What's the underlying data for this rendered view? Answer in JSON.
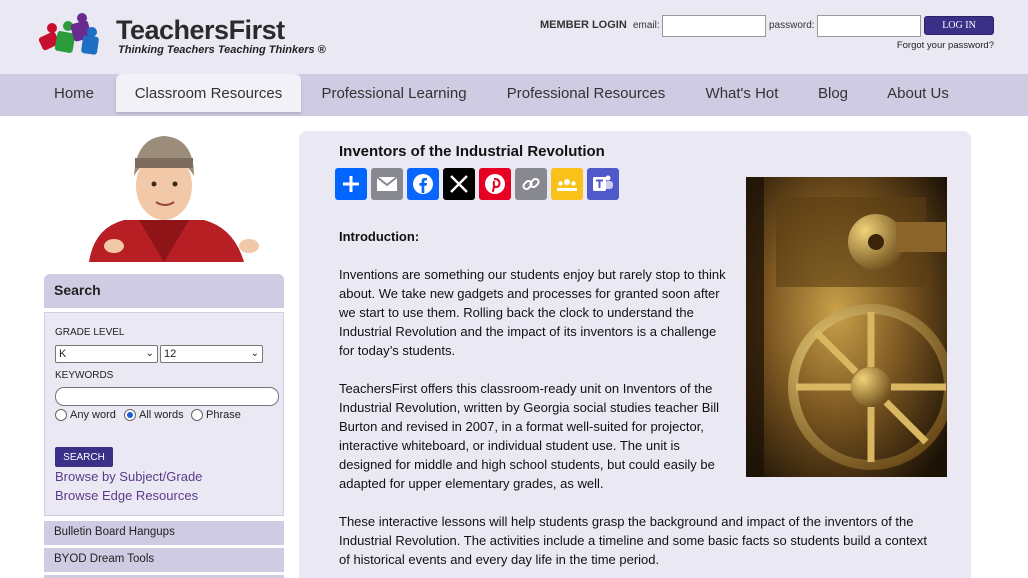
{
  "header": {
    "logo_name": "TeachersFirst",
    "logo_tagline": "Thinking Teachers Teaching Thinkers ®",
    "member_login_label": "MEMBER LOGIN",
    "email_label": "email:",
    "password_label": "password:",
    "login_button": "LOG IN",
    "forgot_password": "Forgot your password?"
  },
  "nav": {
    "items": [
      {
        "label": "Home"
      },
      {
        "label": "Classroom Resources",
        "active": true
      },
      {
        "label": "Professional Learning"
      },
      {
        "label": "Professional Resources"
      },
      {
        "label": "What's Hot"
      },
      {
        "label": "Blog"
      },
      {
        "label": "About Us"
      }
    ]
  },
  "sidebar": {
    "search_title": "Search",
    "grade_level_label": "GRADE LEVEL",
    "grade_from": "K",
    "grade_to": "12",
    "keywords_label": "KEYWORDS",
    "radio_any": "Any word",
    "radio_all": "All words",
    "radio_phrase": "Phrase",
    "search_button": "SEARCH",
    "browse_subject": "Browse by Subject/Grade",
    "browse_edge": "Browse Edge Resources",
    "menu": [
      "Bulletin Board Hangups",
      "BYOD Dream Tools"
    ]
  },
  "article": {
    "title": "Inventors of the Industrial Revolution",
    "share_icons": [
      "share-plus-icon",
      "email-icon",
      "facebook-icon",
      "x-icon",
      "pinterest-icon",
      "copy-link-icon",
      "google-classroom-icon",
      "teams-icon"
    ],
    "intro_heading": "Introduction:",
    "para1": "Inventions are something our students enjoy but rarely stop to think about.  We take new gadgets and processes for granted soon after we start to use them. Rolling back the clock to understand the Industrial Revolution and the impact of its inventors is a challenge for today’s students.",
    "para2": "TeachersFirst offers this classroom-ready unit on Inventors of the Industrial Revolution, written by Georgia social studies teacher Bill Burton and revised in 2007, in a format well-suited for projector, interactive whiteboard, or individual student use. The unit is designed for middle and high school students, but could easily be adapted for upper elementary grades, as well.",
    "para3": "These interactive lessons will help students grasp the background and impact of the inventors of the Industrial Revolution. The activities include a timeline and some basic facts so students build a context of historical events and every day life in the time period."
  },
  "colors": {
    "brand_purple": "#3b3087",
    "nav_bg": "#cfcbe3",
    "panel_bg": "#eae9f3",
    "link": "#5b3a8c"
  }
}
